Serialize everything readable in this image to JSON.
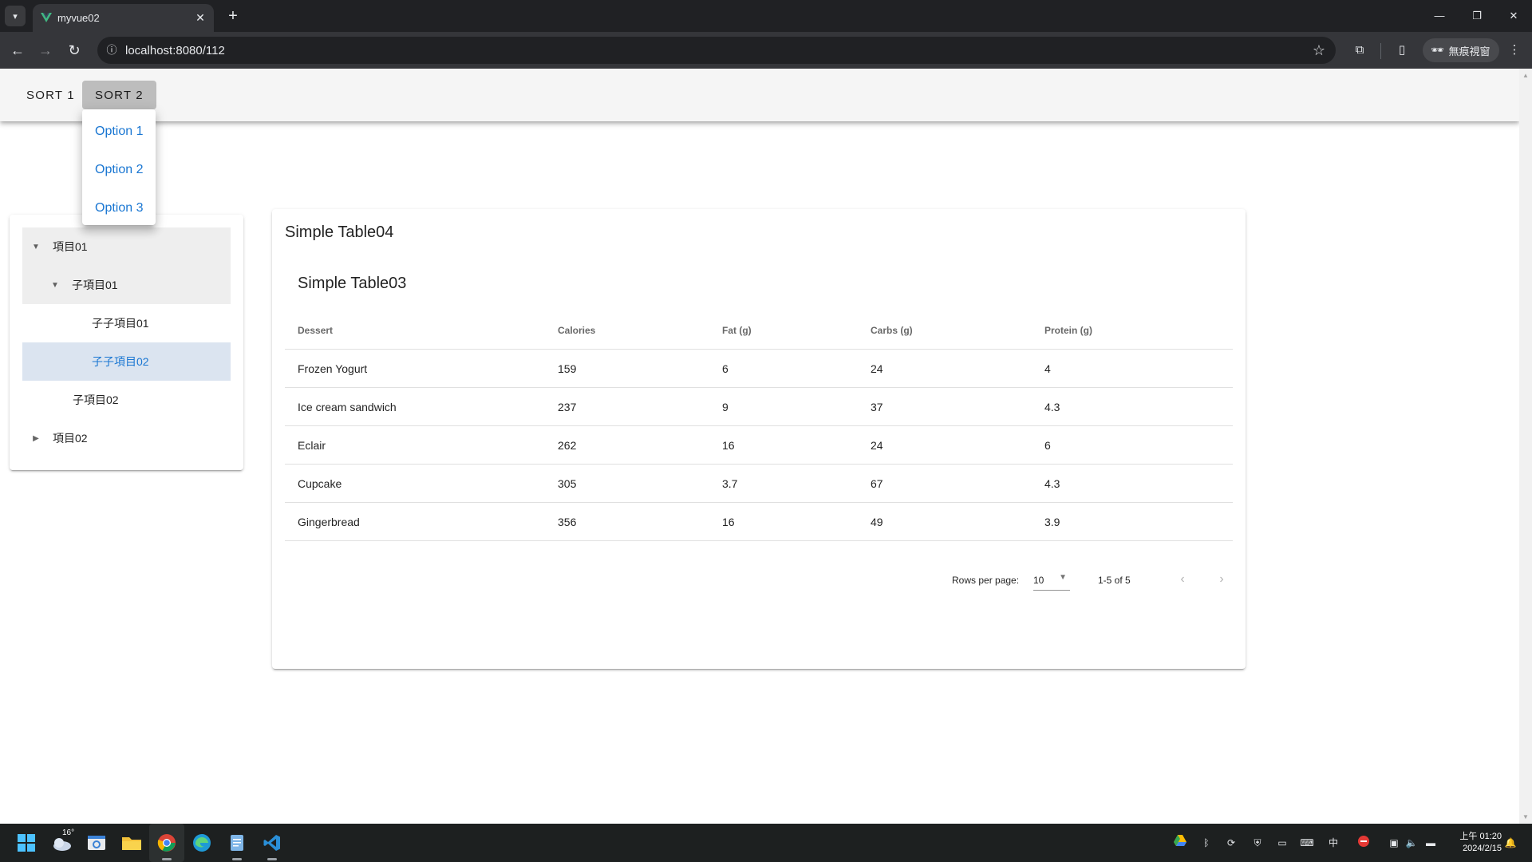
{
  "browser": {
    "tab_title": "myvue02",
    "url": "localhost:8080/112",
    "incognito_label": "無痕視窗",
    "icons": {
      "tab_list": "chevron-down-icon",
      "close_tab": "close-icon",
      "new_tab": "plus-icon",
      "back": "arrow-left-icon",
      "forward": "arrow-right-icon",
      "reload": "reload-icon",
      "site_info": "info-icon",
      "bookmark": "star-icon",
      "extensions": "puzzle-icon",
      "side_panel": "side-panel-icon",
      "menu": "more-vert-icon"
    }
  },
  "app_bar": {
    "sort1_label": "SORT 1",
    "sort2_label": "SORT 2"
  },
  "menu": {
    "items": [
      "Option 1",
      "Option 2",
      "Option 3"
    ]
  },
  "tree": {
    "items": [
      {
        "label": "項目01",
        "expanded": true
      },
      {
        "label": "子項目01",
        "expanded": true
      },
      {
        "label": "子子項目01"
      },
      {
        "label": "子子項目02",
        "selected": true
      },
      {
        "label": "子項目02"
      },
      {
        "label": "項目02",
        "expanded": false
      }
    ]
  },
  "card": {
    "title": "Simple Table04",
    "inner_title": "Simple Table03"
  },
  "table": {
    "headers": [
      "Dessert",
      "Calories",
      "Fat (g)",
      "Carbs (g)",
      "Protein (g)"
    ],
    "rows": [
      [
        "Frozen Yogurt",
        "159",
        "6",
        "24",
        "4"
      ],
      [
        "Ice cream sandwich",
        "237",
        "9",
        "37",
        "4.3"
      ],
      [
        "Eclair",
        "262",
        "16",
        "24",
        "6"
      ],
      [
        "Cupcake",
        "305",
        "3.7",
        "67",
        "4.3"
      ],
      [
        "Gingerbread",
        "356",
        "16",
        "49",
        "3.9"
      ]
    ],
    "footer": {
      "rows_per_page_label": "Rows per page:",
      "rows_per_page_value": "10",
      "page_info": "1-5 of 5"
    }
  },
  "taskbar": {
    "weather_temp": "16°",
    "clock_time": "上午 01:20",
    "clock_date": "2024/2/15",
    "ime_label": "中"
  },
  "colors": {
    "primary": "#1976d2",
    "selected_bg": "#dbe4f0",
    "app_bar_bg": "#f5f5f5",
    "active_button_bg": "#bdbdbd"
  }
}
